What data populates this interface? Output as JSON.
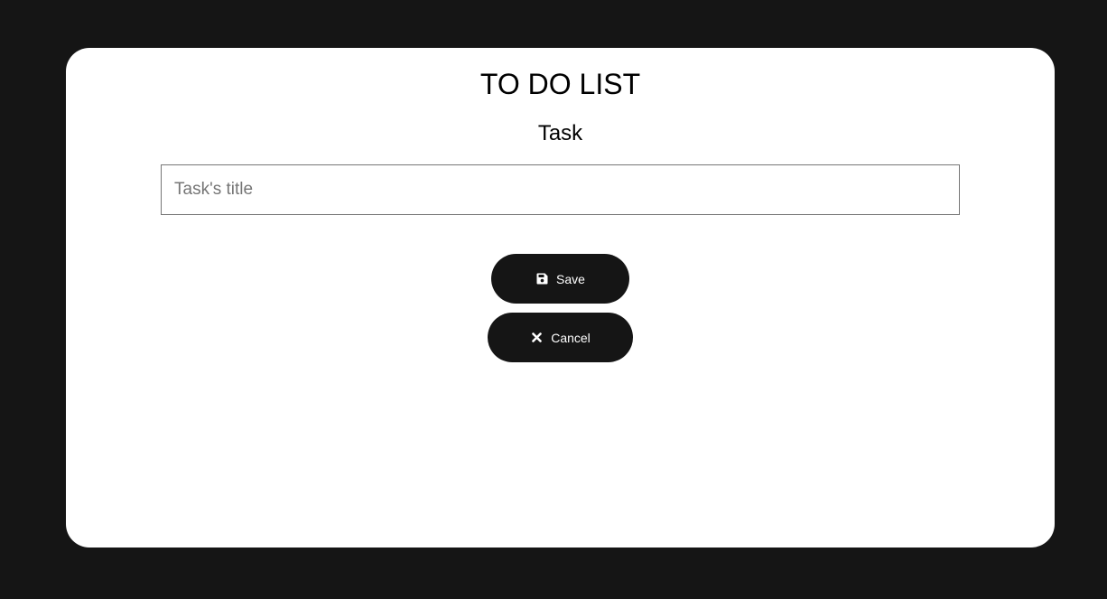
{
  "app": {
    "title": "TO DO LIST"
  },
  "form": {
    "section_title": "Task",
    "title_input": {
      "placeholder": "Task's title",
      "value": ""
    },
    "save_button": {
      "label": "Save",
      "icon": "floppy-disk-icon"
    },
    "cancel_button": {
      "label": "Cancel",
      "icon": "close-icon"
    }
  },
  "colors": {
    "background": "#151515",
    "card": "#ffffff",
    "button": "#151515",
    "button_text": "#ffffff"
  }
}
